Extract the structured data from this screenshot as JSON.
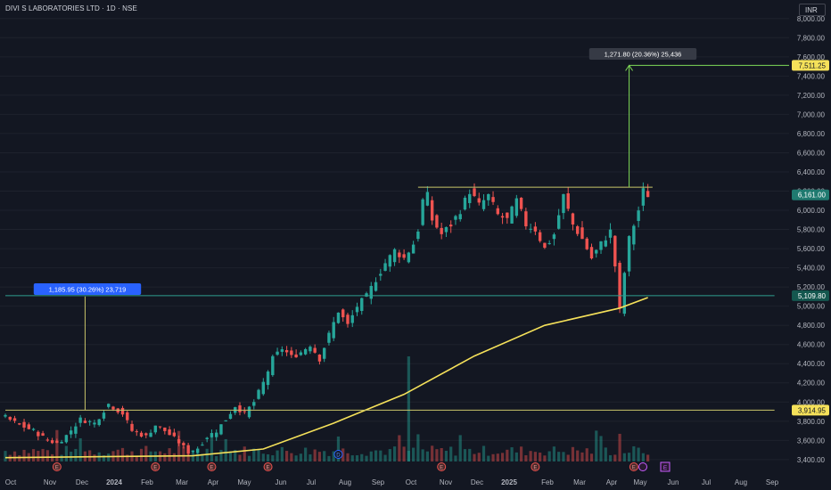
{
  "header": {
    "title": "DIVI S LABORATORIES LTD · 1D · NSE",
    "currency": "INR"
  },
  "colors": {
    "background": "#131722",
    "up": "#26a69a",
    "down": "#ef5350",
    "ma": "#f5e15a",
    "levels": "#c9c56a",
    "measure": "#7ed957",
    "grid": "#1e222d",
    "text": "#b2b5be"
  },
  "annotations": {
    "measure_2024": "1,185.95 (30.26%) 23,719",
    "measure_2025": "1,271.80 (20.36%) 25,436"
  },
  "price_labels": {
    "target": "7,511.25",
    "current": "6,161.00",
    "level_mid": "5,109.80",
    "level_low": "3,914.95"
  },
  "chart_data": {
    "type": "candlestick",
    "ylim": [
      3380,
      8100
    ],
    "y_ticks": [
      3400,
      3600,
      3800,
      4000,
      4200,
      4400,
      4600,
      4800,
      5000,
      5200,
      5400,
      5600,
      5800,
      6000,
      6200,
      6400,
      6600,
      6800,
      7000,
      7200,
      7400,
      7600,
      7800,
      8000
    ],
    "y_tick_labels": [
      "3,400.00",
      "3,600.00",
      "3,800.00",
      "4,000.00",
      "4,200.00",
      "4,400.00",
      "4,600.00",
      "4,800.00",
      "5,000.00",
      "5,200.00",
      "5,400.00",
      "5,600.00",
      "5,800.00",
      "6,000.00",
      "6,200.00",
      "6,400.00",
      "6,600.00",
      "6,800.00",
      "7,000.00",
      "7,200.00",
      "7,400.00",
      "7,600.00",
      "7,800.00",
      "8,000.00"
    ],
    "x_labels": [
      "Oct",
      "Nov",
      "Dec",
      "2024",
      "Feb",
      "Mar",
      "Apr",
      "May",
      "Jun",
      "Jul",
      "Aug",
      "Sep",
      "Oct",
      "Nov",
      "Dec",
      "2025",
      "Feb",
      "Mar",
      "Apr",
      "May",
      "Jun",
      "Jul",
      "Aug",
      "Sep"
    ],
    "price_path": [
      [
        0,
        3840
      ],
      [
        3,
        3760
      ],
      [
        6,
        3700
      ],
      [
        9,
        3600
      ],
      [
        11,
        3570
      ],
      [
        13,
        3650
      ],
      [
        16,
        3820
      ],
      [
        19,
        3780
      ],
      [
        22,
        3980
      ],
      [
        25,
        3880
      ],
      [
        27,
        3700
      ],
      [
        30,
        3640
      ],
      [
        32,
        3760
      ],
      [
        34,
        3700
      ],
      [
        37,
        3580
      ],
      [
        39,
        3480
      ],
      [
        41,
        3520
      ],
      [
        43,
        3640
      ],
      [
        45,
        3700
      ],
      [
        47,
        3820
      ],
      [
        49,
        3960
      ],
      [
        51,
        3880
      ],
      [
        53,
        4000
      ],
      [
        55,
        4200
      ],
      [
        57,
        4450
      ],
      [
        59,
        4560
      ],
      [
        61,
        4470
      ],
      [
        63,
        4520
      ],
      [
        65,
        4600
      ],
      [
        67,
        4450
      ],
      [
        69,
        4700
      ],
      [
        71,
        4950
      ],
      [
        73,
        4800
      ],
      [
        75,
        5000
      ],
      [
        77,
        5100
      ],
      [
        79,
        5280
      ],
      [
        81,
        5450
      ],
      [
        83,
        5580
      ],
      [
        85,
        5500
      ],
      [
        87,
        5650
      ],
      [
        88,
        5800
      ],
      [
        89,
        6100
      ],
      [
        90,
        6150
      ],
      [
        91,
        5900
      ],
      [
        93,
        5750
      ],
      [
        95,
        5850
      ],
      [
        97,
        6000
      ],
      [
        99,
        6200
      ],
      [
        101,
        6050
      ],
      [
        103,
        6150
      ],
      [
        105,
        5950
      ],
      [
        107,
        5900
      ],
      [
        109,
        6100
      ],
      [
        111,
        5850
      ],
      [
        113,
        5800
      ],
      [
        115,
        5600
      ],
      [
        117,
        5750
      ],
      [
        119,
        6150
      ],
      [
        121,
        5850
      ],
      [
        123,
        5700
      ],
      [
        125,
        5500
      ],
      [
        127,
        5650
      ],
      [
        129,
        5780
      ],
      [
        130,
        5420
      ],
      [
        131,
        4950
      ],
      [
        132,
        5350
      ],
      [
        133,
        5700
      ],
      [
        135,
        6000
      ],
      [
        136,
        6200
      ],
      [
        137,
        6161
      ]
    ],
    "moving_average_200": [
      [
        0,
        3420
      ],
      [
        40,
        3440
      ],
      [
        55,
        3510
      ],
      [
        70,
        3780
      ],
      [
        85,
        4080
      ],
      [
        100,
        4480
      ],
      [
        115,
        4800
      ],
      [
        131,
        4980
      ],
      [
        137,
        5090
      ]
    ],
    "horizontal_levels": [
      {
        "value": 6240,
        "x_start": 88,
        "x_end": 138
      },
      {
        "value": 5109.8,
        "x_start": 0,
        "x_end": 164
      },
      {
        "value": 3914.95,
        "x_start": 0,
        "x_end": 164
      }
    ],
    "measures": [
      {
        "x": 17,
        "from": 3914.95,
        "to": 5100.9
      },
      {
        "x": 133,
        "from": 6239.45,
        "to": 7511.25
      }
    ],
    "event_markers": [
      {
        "x": 11,
        "letter": "E"
      },
      {
        "x": 32,
        "letter": "E"
      },
      {
        "x": 44,
        "letter": "E"
      },
      {
        "x": 56,
        "letter": "E"
      },
      {
        "x": 71,
        "letter": "D"
      },
      {
        "x": 93,
        "letter": "E"
      },
      {
        "x": 113,
        "letter": "E"
      },
      {
        "x": 134,
        "letter": "E"
      }
    ]
  }
}
